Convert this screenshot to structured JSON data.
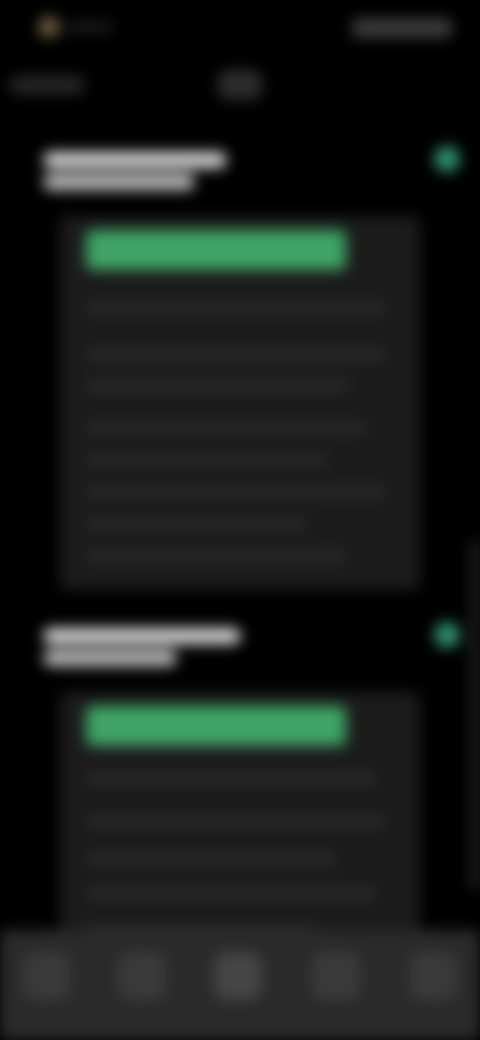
{
  "colors": {
    "background": "#000000",
    "card": "#1b1b1b",
    "accent_green": "#3fa466",
    "accent_teal": "#2f8f6f",
    "nav_bar": "#2a2a2a"
  },
  "icons": {
    "status_left": "notification-dot-icon",
    "post_action": "more-icon",
    "nav": [
      "home-icon",
      "search-icon",
      "create-icon",
      "activity-icon",
      "profile-icon"
    ]
  },
  "posts": [
    {
      "header_lines": 2,
      "text_lines": 8
    },
    {
      "header_lines": 2,
      "text_lines": 5
    }
  ]
}
